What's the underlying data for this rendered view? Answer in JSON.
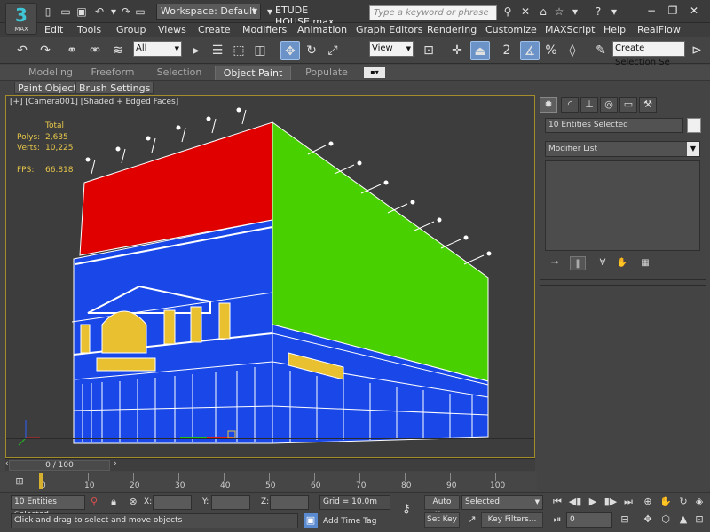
{
  "titlebar": {
    "logo_sub": "MAX",
    "workspace": "Workspace: Default",
    "document_title": "ETUDE HOUSE.max",
    "search_placeholder": "Type a keyword or phrase"
  },
  "menu": [
    "Edit",
    "Tools",
    "Group",
    "Views",
    "Create",
    "Modifiers",
    "Animation",
    "Graph Editors",
    "Rendering",
    "Customize",
    "MAXScript",
    "Help",
    "RealFlow"
  ],
  "toolbar": {
    "selection_filter": "All",
    "ref_coord": "View",
    "snap_label": "2",
    "angle_label": "n",
    "selection_set_placeholder": "Create Selection Se"
  },
  "ribbon": {
    "tabs": [
      "Modeling",
      "Freeform",
      "Selection",
      "Object Paint",
      "Populate"
    ],
    "active_tab": "Object Paint",
    "subtabs": [
      "Paint Objects",
      "Brush Settings"
    ]
  },
  "viewport": {
    "label": "[+] [Camera001] [Shaded + Edged Faces]",
    "stats": {
      "total_label": "Total",
      "polys_label": "Polys:",
      "polys_value": "2,635",
      "verts_label": "Verts:",
      "verts_value": "10,225",
      "fps_label": "FPS:",
      "fps_value": "66.818"
    }
  },
  "command_panel": {
    "selection_name": "10 Entities Selected",
    "modifier_list": "Modifier List"
  },
  "timeline": {
    "frame_display": "0 / 100",
    "ticks": [
      "0",
      "10",
      "20",
      "30",
      "40",
      "50",
      "60",
      "70",
      "80",
      "90",
      "100"
    ]
  },
  "status": {
    "selection_info": "10 Entities Selected",
    "prompt": "Click and drag to select and move objects",
    "x_label": "X:",
    "y_label": "Y:",
    "z_label": "Z:",
    "grid": "Grid = 10.0m",
    "add_time_tag": "Add Time Tag",
    "auto_key": "Auto Key",
    "set_key": "Set Key",
    "key_mode": "Selected",
    "key_filters": "Key Filters...",
    "frame_value": "0"
  },
  "colors": {
    "billboard_left": "#e00000",
    "billboard_right": "#48d000",
    "building": "#1a48e8",
    "wire": "#ffffff",
    "window_fill": "#e8c030",
    "viewport_border": "#a58c2a",
    "active_button": "#6b93c8"
  }
}
